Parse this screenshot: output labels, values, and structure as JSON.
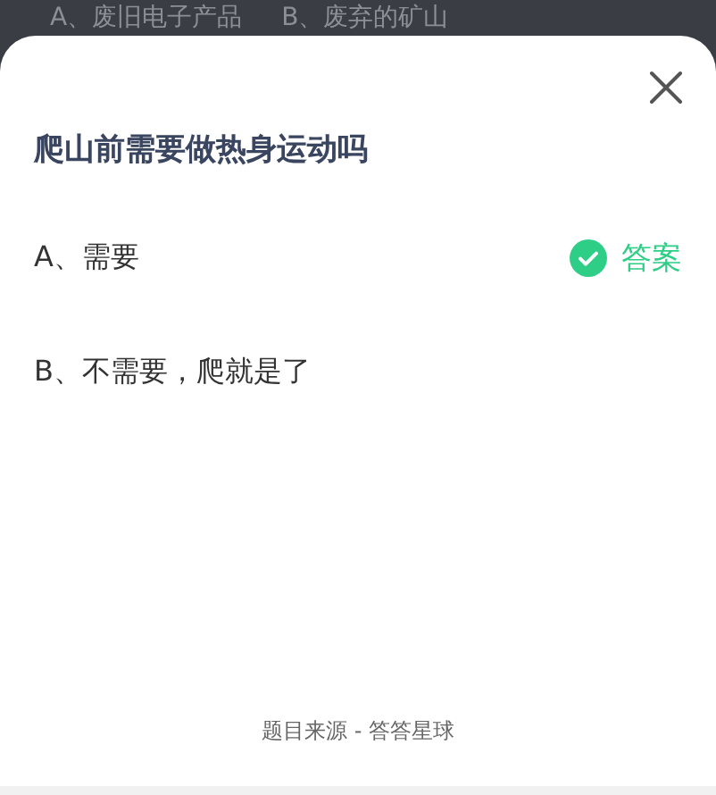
{
  "background_options": [
    "A、废旧电子产品",
    "B、废弃的矿山"
  ],
  "question": "爬山前需要做热身运动吗",
  "options": [
    {
      "label": "A、需要",
      "correct": true
    },
    {
      "label": "B、不需要，爬就是了",
      "correct": false
    }
  ],
  "answer_label": "答案",
  "source": "题目来源 - 答答星球"
}
